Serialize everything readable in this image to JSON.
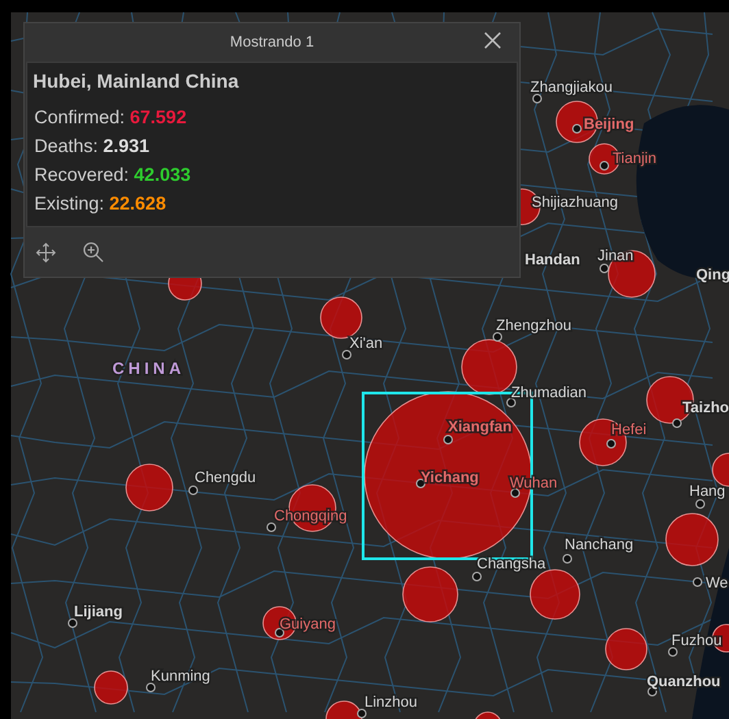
{
  "popup": {
    "title": "Mostrando 1",
    "place": "Hubei, Mainland China",
    "stats": [
      {
        "label": "Confirmed:",
        "value": "67.592",
        "color": "#e8193c"
      },
      {
        "label": "Deaths:",
        "value": "2.931",
        "color": "#dddddd"
      },
      {
        "label": "Recovered:",
        "value": "42.033",
        "color": "#2ecc2e"
      },
      {
        "label": "Existing:",
        "value": "22.628",
        "color": "#ff8c00"
      }
    ]
  },
  "map": {
    "country_label": "CHINA",
    "cities": [
      {
        "name": "Zhangjiakou"
      },
      {
        "name": "Beijing"
      },
      {
        "name": "Tianjin"
      },
      {
        "name": "Shijiazhuang"
      },
      {
        "name": "Handan"
      },
      {
        "name": "Jinan"
      },
      {
        "name": "Qing"
      },
      {
        "name": "Zhengzhou"
      },
      {
        "name": "Xi'an"
      },
      {
        "name": "Zhumadian"
      },
      {
        "name": "Xiangfan"
      },
      {
        "name": "Yichang"
      },
      {
        "name": "Wuhan"
      },
      {
        "name": "Hefei"
      },
      {
        "name": "Taizho"
      },
      {
        "name": "Chengdu"
      },
      {
        "name": "Hang"
      },
      {
        "name": "Chongqing"
      },
      {
        "name": "Changsha"
      },
      {
        "name": "Nanchang"
      },
      {
        "name": "We"
      },
      {
        "name": "Lijiang"
      },
      {
        "name": "Guiyang"
      },
      {
        "name": "Fuzhou"
      },
      {
        "name": "Quanzhou"
      },
      {
        "name": "Kunming"
      },
      {
        "name": "Linzhou"
      }
    ]
  }
}
